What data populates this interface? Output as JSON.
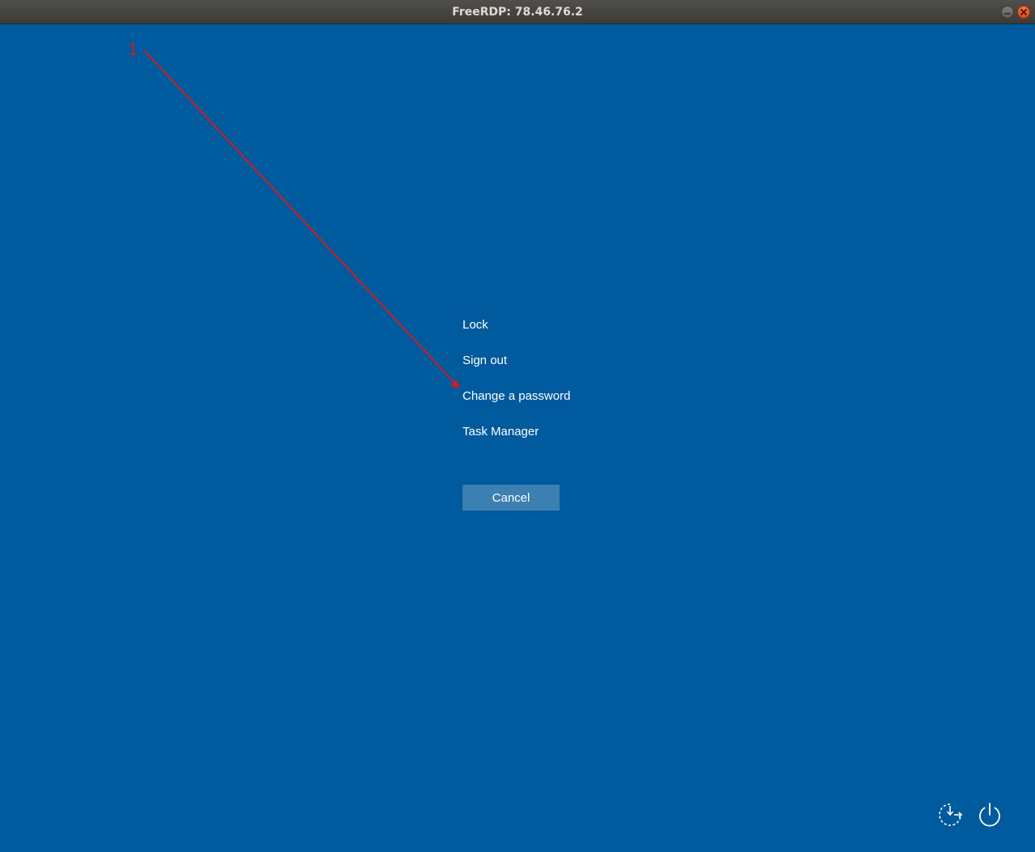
{
  "window": {
    "title": "FreeRDP: 78.46.76.2"
  },
  "menu": {
    "items": [
      {
        "label": "Lock"
      },
      {
        "label": "Sign out"
      },
      {
        "label": "Change a password"
      },
      {
        "label": "Task Manager"
      }
    ],
    "cancel_label": "Cancel"
  },
  "annotation": {
    "label": "1"
  },
  "system_icons": {
    "left": "ease-of-access-icon",
    "right": "power-icon"
  },
  "colors": {
    "background": "#005a9e",
    "button": "#3c7fb1",
    "annotation": "#cc1f1f"
  }
}
